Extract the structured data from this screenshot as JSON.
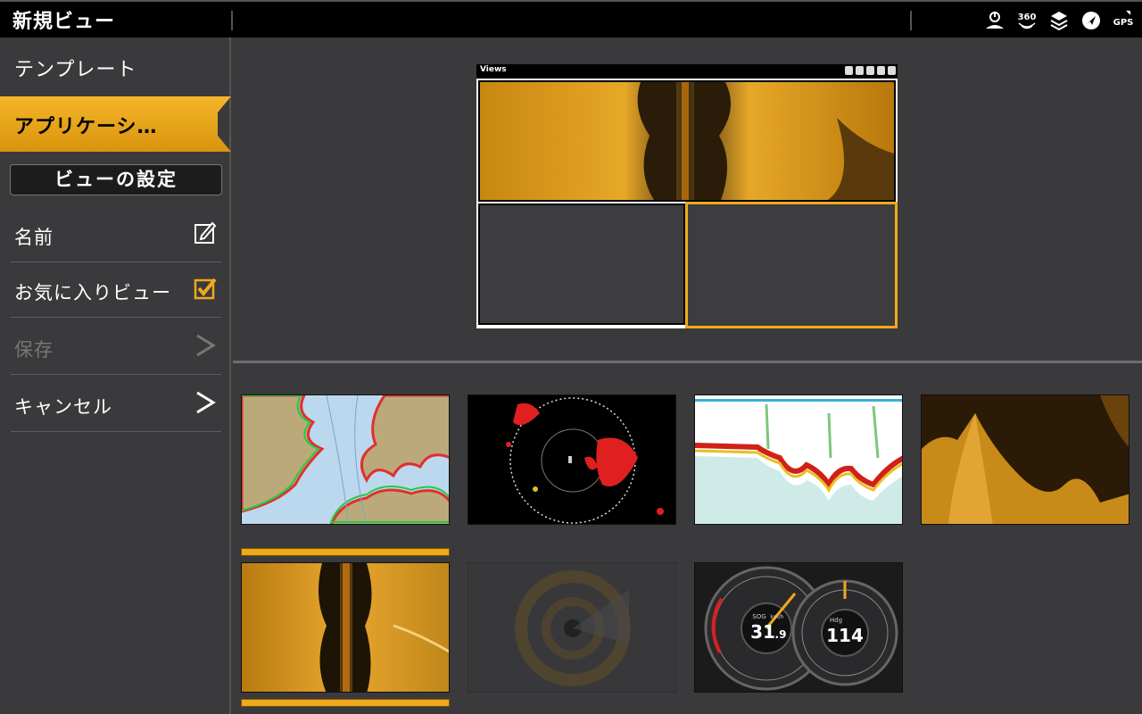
{
  "topbar": {
    "title": "新規ビュー",
    "status_icons": [
      "power-icon",
      "360-icon",
      "layers-icon",
      "navigation-icon",
      "gps-icon"
    ],
    "status_360": "360",
    "status_gps": "GPS"
  },
  "sidebar": {
    "template_label": "テンプレート",
    "applications_label": "アプリケーシ…",
    "view_settings_label": "ビューの設定",
    "rows": [
      {
        "label": "名前",
        "icon": "edit-icon",
        "enabled": true
      },
      {
        "label": "お気に入りビュー",
        "icon": "checkbox-checked-icon",
        "enabled": true
      },
      {
        "label": "保存",
        "icon": "chevron-right-icon",
        "enabled": false
      },
      {
        "label": "キャンセル",
        "icon": "chevron-right-icon",
        "enabled": true
      }
    ]
  },
  "preview": {
    "title": "Views",
    "layout": "top-wide-bottom-two",
    "selected_pane": "bottom-right"
  },
  "thumbnails": [
    {
      "name": "chart-view",
      "selected": false
    },
    {
      "name": "radar-view",
      "selected": false
    },
    {
      "name": "sonar-view",
      "selected": false
    },
    {
      "name": "side-imaging-view",
      "selected": false
    },
    {
      "name": "down-imaging-view",
      "selected": true
    },
    {
      "name": "360-imaging-view",
      "selected": false,
      "disabled": true
    },
    {
      "name": "gauges-view",
      "selected": false
    }
  ],
  "gauges": {
    "speed_value": "31",
    "speed_decimal": ".9",
    "speed_label": "SOG",
    "speed_unit": "km/h",
    "heading_value": "114",
    "heading_label": "Hdg"
  },
  "colors": {
    "accent": "#f0a91c",
    "background": "#3a3a3c",
    "topbar": "#000000"
  }
}
